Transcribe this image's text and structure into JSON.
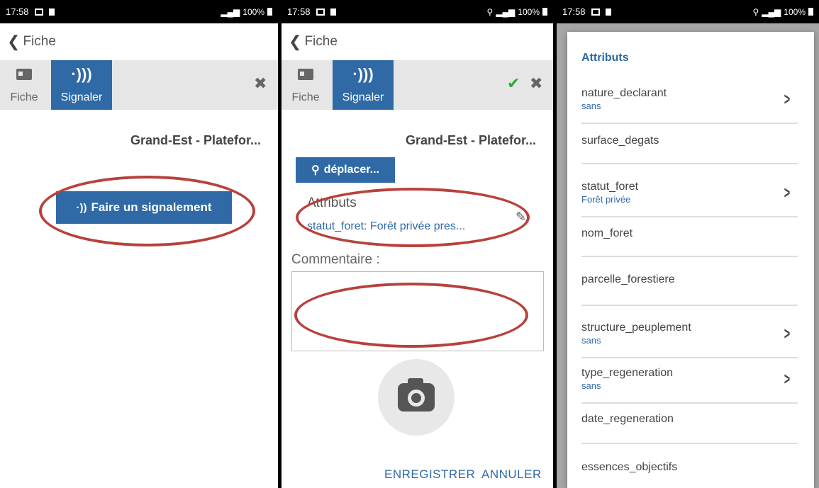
{
  "status_bar": {
    "time": "17:58",
    "battery": "100%"
  },
  "nav": {
    "back_label": "Fiche"
  },
  "tabs": {
    "fiche": "Fiche",
    "signaler": "Signaler"
  },
  "panel1": {
    "title": "Grand-Est - Platefor...",
    "report_button": "Faire un signalement"
  },
  "panel2": {
    "title": "Grand-Est - Platefor...",
    "move_button": "déplacer...",
    "attributes_heading": "Attributs",
    "attributes_value": "statut_foret: Forêt privée pres...",
    "comment_label": "Commentaire :",
    "save_button": "ENREGISTRER",
    "cancel_button": "ANNULER"
  },
  "panel3": {
    "dialog_title": "Attributs",
    "rows": [
      {
        "name": "nature_declarant",
        "value": "sans"
      },
      {
        "name": "surface_degats",
        "value": ""
      },
      {
        "name": "statut_foret",
        "value": "Forêt privée"
      },
      {
        "name": "nom_foret",
        "value": ""
      },
      {
        "name": "parcelle_forestiere",
        "value": ""
      },
      {
        "name": "structure_peuplement",
        "value": "sans"
      },
      {
        "name": "type_regeneration",
        "value": "sans"
      },
      {
        "name": "date_regeneration",
        "value": ""
      },
      {
        "name": "essences_objectifs",
        "value": ""
      }
    ]
  },
  "colors": {
    "accent": "#2f6aa6",
    "highlight_ellipse": "#b8413c",
    "check": "#2eaa2e"
  },
  "icons": [
    "chevron-left-icon",
    "card-icon",
    "signal-icon",
    "close-icon",
    "check-icon",
    "pin-icon",
    "pencil-icon",
    "camera-icon",
    "chevron-right-icon"
  ]
}
